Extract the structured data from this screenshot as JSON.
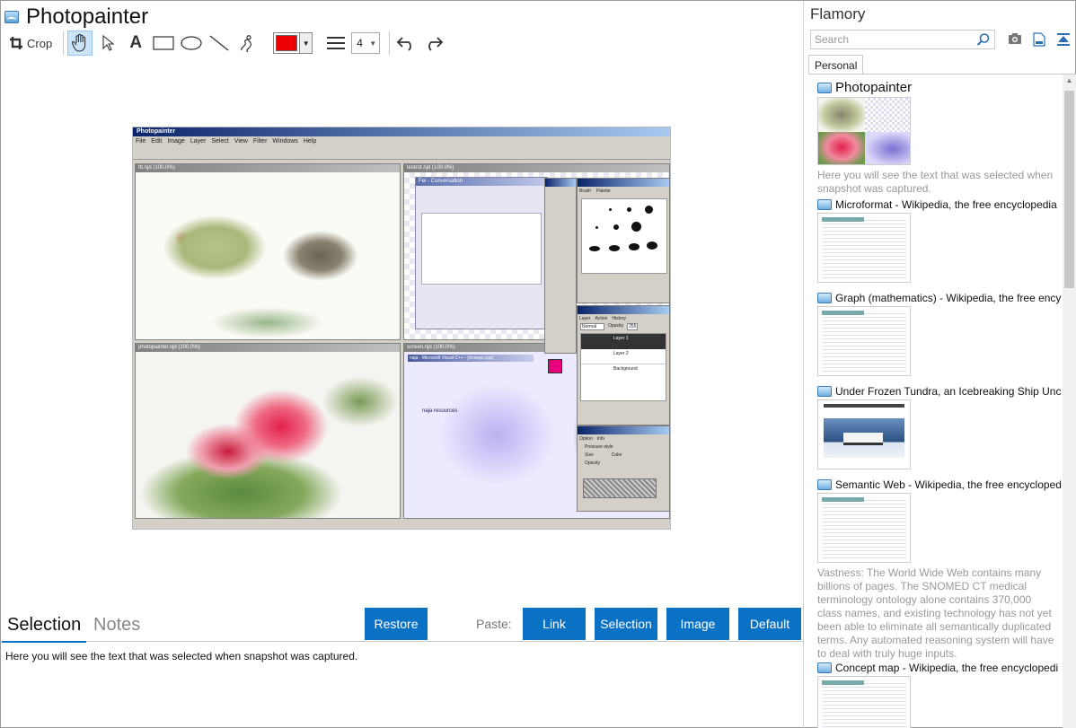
{
  "app": {
    "title": "Photopainter"
  },
  "toolbar": {
    "crop_label": "Crop",
    "text_tool_glyph": "A",
    "color": "#ee0000",
    "line_width": "4"
  },
  "bottom": {
    "tabs": [
      "Selection",
      "Notes"
    ],
    "restore_label": "Restore",
    "paste_label": "Paste:",
    "paste_buttons": [
      "Link",
      "Selection",
      "Image",
      "Default"
    ],
    "selection_text": "Here you will see the text that was selected when snapshot was captured."
  },
  "flamory": {
    "title": "Flamory",
    "search_placeholder": "Search",
    "tab": "Personal",
    "entries": [
      {
        "title": "Photopainter",
        "desc": "Here you will see the text that was selected when snapshot was captured."
      },
      {
        "title": "Microformat - Wikipedia, the free encyclopedia"
      },
      {
        "title": "Graph (mathematics) - Wikipedia, the free ency"
      },
      {
        "title": "Under Frozen Tundra, an Icebreaking Ship Unco"
      },
      {
        "title": "Semantic Web - Wikipedia, the free encycloped",
        "desc": "Vastness: The World Wide Web contains many billions of pages. The SNOMED CT medical terminology ontology alone contains 370,000 class names, and existing technology has not yet been able to eliminate all semantically duplicated terms. Any automated reasoning system will have to deal with truly huge inputs."
      },
      {
        "title": "Concept map - Wikipedia, the free encyclopedi"
      }
    ]
  },
  "snapshot": {
    "app_title": "Photopainter",
    "menu": [
      "File",
      "Edit",
      "Image",
      "Layer",
      "Select",
      "View",
      "Filter",
      "Windows",
      "Help"
    ],
    "windows": [
      "ttt.njd (100.0%)",
      "testrot.njd (100.0%)",
      "photopainter.njd (100.0%)",
      "screen.njd (100.0%)"
    ],
    "chat_title": "Fei - Conversation",
    "layers": [
      "Layer 1",
      "Layer 2",
      "Background"
    ],
    "blend_mode": "Normal",
    "opacity_label": "Opacity",
    "opacity_value": "255",
    "panel_tabs": [
      "Brush",
      "Palette",
      "Layer",
      "Action",
      "History",
      "Option",
      "Info"
    ],
    "pressure_style": "Pressure style",
    "pressure_options": [
      "Size",
      "Color",
      "Opacity"
    ],
    "vc_title": "naja - Microsoft Visual C++ - [drawpp.cpp]",
    "vc_tree": "naja resources"
  }
}
